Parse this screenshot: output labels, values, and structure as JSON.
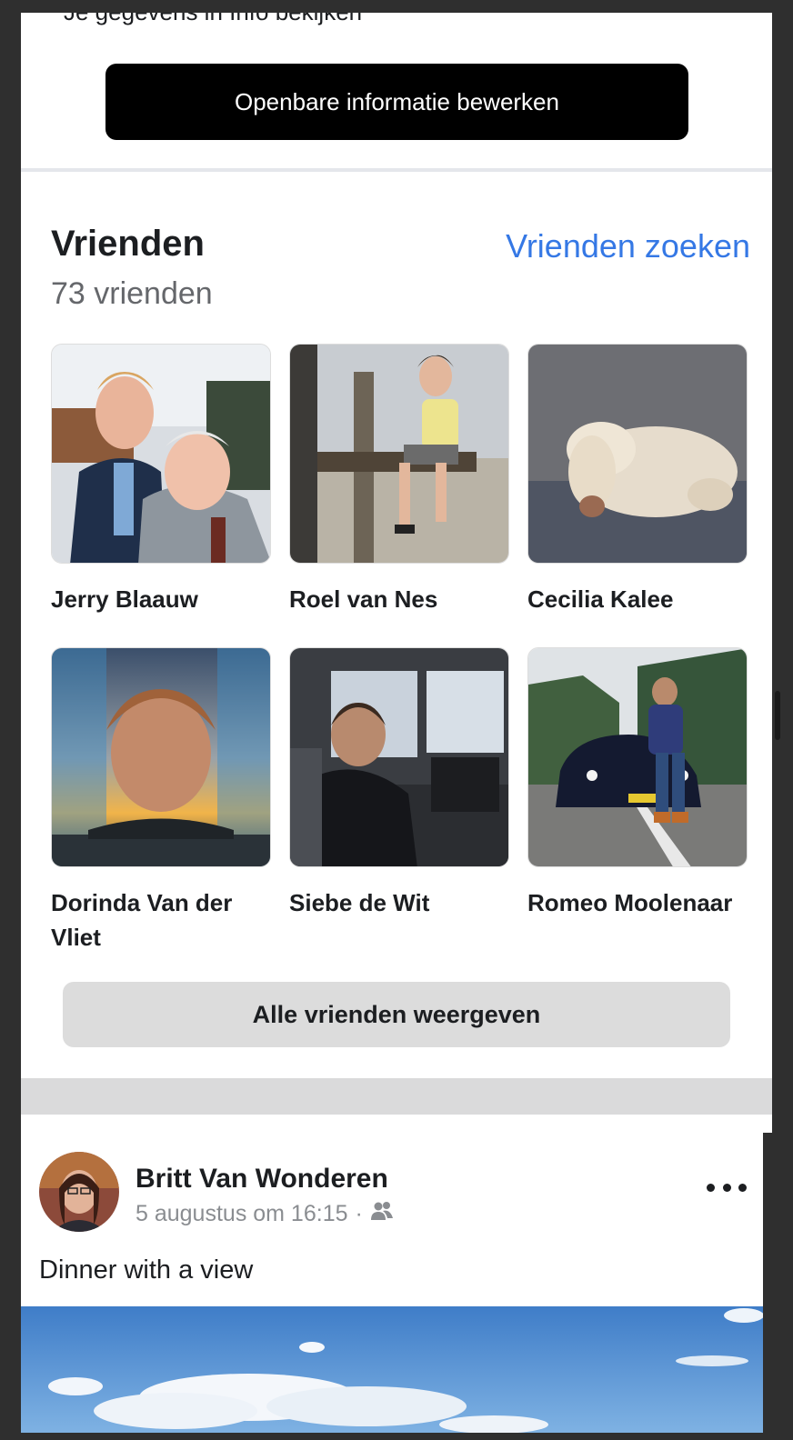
{
  "profile": {
    "cut_off_text": "Je gegevens in Info bekijken",
    "edit_public_info_label": "Openbare informatie bewerken"
  },
  "friends": {
    "title": "Vrienden",
    "count_label": "73 vrienden",
    "find_friends_label": "Vrienden zoeken",
    "list": [
      {
        "name": "Jerry Blaauw"
      },
      {
        "name": "Roel van Nes"
      },
      {
        "name": "Cecilia Kalee"
      },
      {
        "name": "Dorinda Van der Vliet"
      },
      {
        "name": "Siebe de Wit"
      },
      {
        "name": "Romeo Moolenaar"
      }
    ],
    "all_friends_label": "Alle vrienden weergeven"
  },
  "post": {
    "author": "Britt Van Wonderen",
    "timestamp": "5 augustus om 16:15",
    "audience_icon": "friends-icon",
    "text": "Dinner with a view"
  },
  "colors": {
    "link_blue": "#3578e5",
    "primary_button": "#000000",
    "secondary_button": "#dcdcdc",
    "meta_grey": "#8a8d91"
  }
}
